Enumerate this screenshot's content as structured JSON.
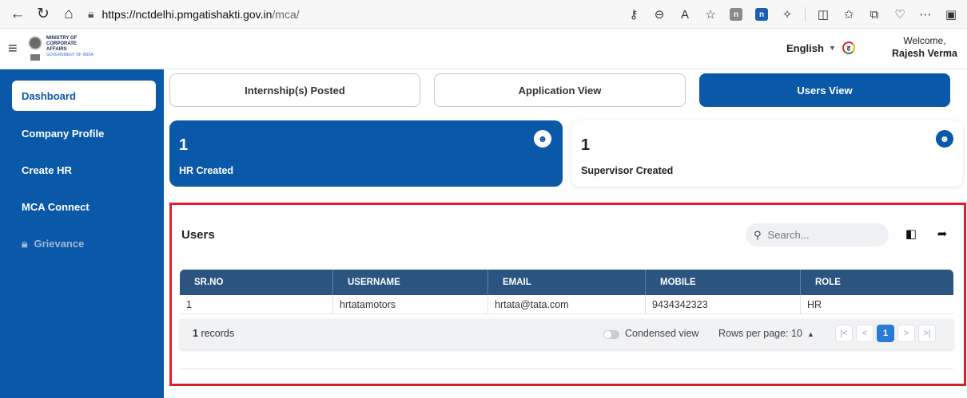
{
  "browser": {
    "back_icon": "arrow-left-icon",
    "refresh_icon": "refresh-icon",
    "home_icon": "home-icon",
    "url_host": "https://nctdelhi.pmgatishakti.gov.in",
    "url_path": "/mca/",
    "ext1": "n",
    "ext2": "n"
  },
  "header": {
    "logo": {
      "line1": "MINISTRY OF",
      "line2": "CORPORATE",
      "line3": "AFFAIRS",
      "line4": "GOVERNMENT OF INDIA"
    },
    "language": "English",
    "language_icon": "ह",
    "welcome": "Welcome,",
    "user_name": "Rajesh Verma"
  },
  "sidebar": {
    "items": [
      {
        "label": "Dashboard"
      },
      {
        "label": "Company Profile"
      },
      {
        "label": "Create HR"
      },
      {
        "label": "MCA Connect"
      },
      {
        "label": "Grievance"
      }
    ]
  },
  "tabs": [
    {
      "label": "Internship(s) Posted"
    },
    {
      "label": "Application View"
    },
    {
      "label": "Users View"
    }
  ],
  "stats": [
    {
      "value": "1",
      "label": "HR Created"
    },
    {
      "value": "1",
      "label": "Supervisor Created"
    }
  ],
  "users": {
    "title": "Users",
    "search_placeholder": "Search...",
    "columns": [
      "SR.NO",
      "USERNAME",
      "EMAIL",
      "MOBILE",
      "ROLE"
    ],
    "rows": [
      [
        "1",
        "hrtatamotors",
        "hrtata@tata.com",
        "9434342323",
        "HR"
      ]
    ],
    "records_count": "1",
    "records_label": "records",
    "condensed_label": "Condensed view",
    "rows_per_page": "Rows per page: 10",
    "pagination": {
      "first": "|<",
      "prev": "<",
      "current": "1",
      "next": ">",
      "last": ">|"
    }
  }
}
